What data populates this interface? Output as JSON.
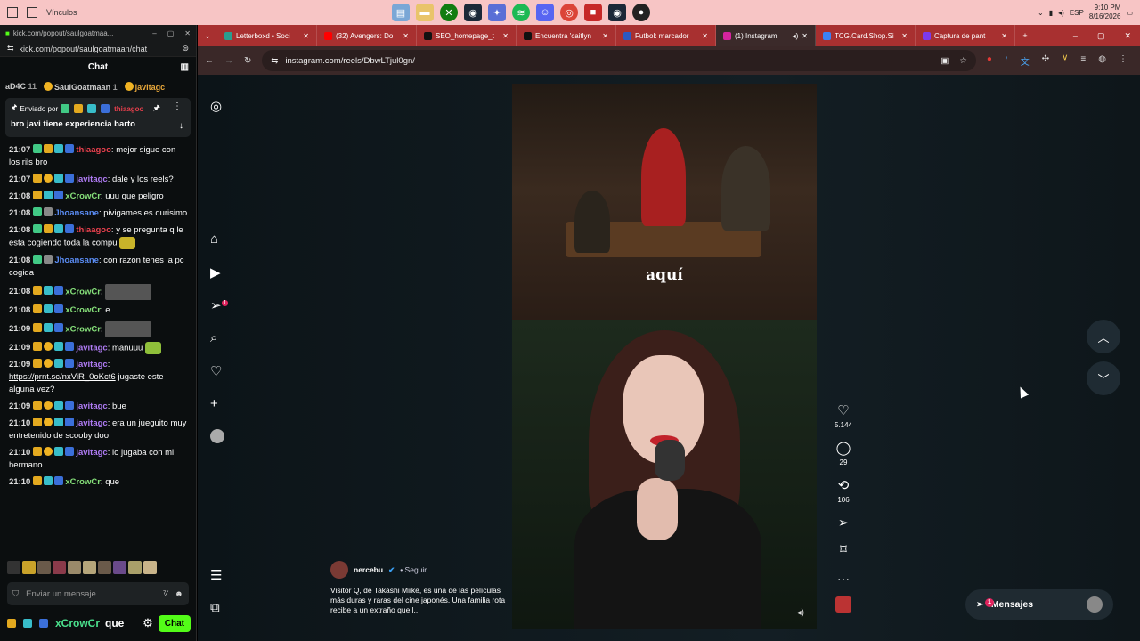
{
  "taskbar": {
    "left_text": "Vínculos",
    "lang": "ESP",
    "time": "9:10 PM",
    "date": "8/16/2026"
  },
  "kick": {
    "window_title": "kick.com/popout/saulgoatmaa...",
    "url": "kick.com/popout/saulgoatmaan/chat",
    "header": "Chat",
    "gifters": [
      {
        "name": "aD4C",
        "count": "11"
      },
      {
        "name": "SaulGoatmaan",
        "count": "1"
      },
      {
        "name": "javitagc",
        "count": ""
      }
    ],
    "pinned": {
      "by_label": "Enviado por",
      "by_user": "thiaagoo",
      "message": "bro javi tiene experiencia barto"
    },
    "messages": [
      {
        "time": "21:07",
        "user": "thiaagoo",
        "color": "red",
        "text": "mejor sigue con los rils bro"
      },
      {
        "time": "21:07",
        "user": "javitagc",
        "color": "pur",
        "text": "dale y los reels?"
      },
      {
        "time": "21:08",
        "user": "xCrowCr",
        "color": "grn",
        "text": "uuu que peligro"
      },
      {
        "time": "21:08",
        "user": "Jhoansane",
        "color": "blu",
        "text": "pivigames es durisimo"
      },
      {
        "time": "21:08",
        "user": "thiaagoo",
        "color": "red",
        "text": "y se pregunta q le esta cogiendo toda la compu"
      },
      {
        "time": "21:08",
        "user": "Jhoansane",
        "color": "blu",
        "text": "con razon tenes la pc cogida"
      },
      {
        "time": "21:08",
        "user": "xCrowCr",
        "color": "grn",
        "text": ""
      },
      {
        "time": "21:08",
        "user": "xCrowCr",
        "color": "grn",
        "text": "e"
      },
      {
        "time": "21:09",
        "user": "xCrowCr",
        "color": "grn",
        "text": ""
      },
      {
        "time": "21:09",
        "user": "javitagc",
        "color": "pur",
        "text": "manuuu"
      },
      {
        "time": "21:09",
        "user": "javitagc",
        "color": "pur",
        "link": "https://prnt.sc/nxViR_0oKct6",
        "text": "jugaste este alguna vez?"
      },
      {
        "time": "21:09",
        "user": "javitagc",
        "color": "pur",
        "text": "bue"
      },
      {
        "time": "21:10",
        "user": "javitagc",
        "color": "pur",
        "text": "era un jueguito muy entretenido de scooby doo"
      },
      {
        "time": "21:10",
        "user": "javitagc",
        "color": "pur",
        "text": "lo jugaba con mi hermano"
      },
      {
        "time": "21:10",
        "user": "xCrowCr",
        "color": "grn",
        "text": "que"
      }
    ],
    "input_placeholder": "Enviar un mensaje",
    "bottom_user": "xCrowCr",
    "bottom_text": "que",
    "chat_button": "Chat"
  },
  "browser": {
    "tabs": [
      {
        "label": "Letterboxd • Soci",
        "color": "#2a9d8f"
      },
      {
        "label": "(32) Avengers: Do",
        "color": "#ff0000"
      },
      {
        "label": "SEO_homepage_t",
        "color": "#111111"
      },
      {
        "label": "Encuentra 'caitlyn",
        "color": "#111111"
      },
      {
        "label": "Futbol: marcador",
        "color": "#2b59c3"
      },
      {
        "label": "(1) Instagram",
        "color": "#d6249f",
        "active": true
      },
      {
        "label": "TCG.Card.Shop.Si",
        "color": "#3b82f6"
      },
      {
        "label": "Captura de pant",
        "color": "#7c3aed"
      }
    ],
    "url": "instagram.com/reels/DbwLTjul0gn/"
  },
  "instagram": {
    "caption": "aquí",
    "likes": "5.144",
    "comments": "29",
    "reposts": "106",
    "username": "nercebu",
    "follow_label": "Seguir",
    "description": "Visitor Q, de Takashi Miike, es una de las películas más duras y raras del cine japonés. Una familia rota recibe a un extraño que l...",
    "messages_label": "Mensajes",
    "messages_badge": "1",
    "notif_badge": "1"
  }
}
